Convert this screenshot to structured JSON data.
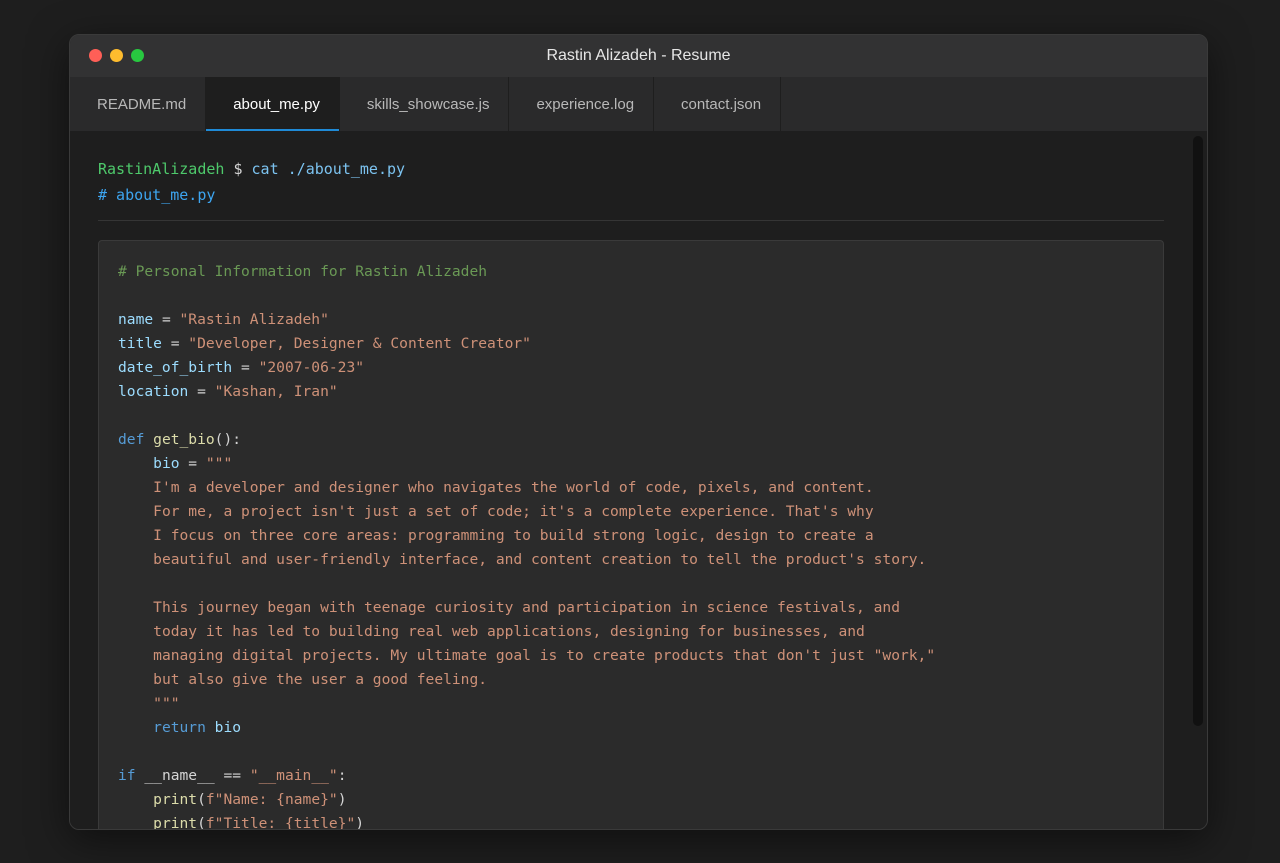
{
  "window": {
    "title": "Rastin Alizadeh - Resume"
  },
  "tabs": [
    {
      "label": "README.md",
      "active": false
    },
    {
      "label": "about_me.py",
      "active": true
    },
    {
      "label": "skills_showcase.js",
      "active": false
    },
    {
      "label": "experience.log",
      "active": false
    },
    {
      "label": "contact.json",
      "active": false
    }
  ],
  "terminal": {
    "prompt_user": "RastinAlizadeh",
    "prompt_symbol": " $ ",
    "command": "cat ./about_me.py",
    "file_comment": "# about_me.py"
  },
  "code": {
    "header_comment": "# Personal Information for Rastin Alizadeh",
    "vars": [
      {
        "name": "name",
        "value": "\"Rastin Alizadeh\""
      },
      {
        "name": "title",
        "value": "\"Developer, Designer & Content Creator\""
      },
      {
        "name": "date_of_birth",
        "value": "\"2007-06-23\""
      },
      {
        "name": "location",
        "value": "\"Kashan, Iran\""
      }
    ],
    "def_kw": "def",
    "fn_name": "get_bio",
    "fn_sig": "():",
    "bio_var": "bio",
    "bio_open": "\"\"\"",
    "bio_lines": [
      "I'm a developer and designer who navigates the world of code, pixels, and content.",
      "For me, a project isn't just a set of code; it's a complete experience. That's why",
      "I focus on three core areas: programming to build strong logic, design to create a",
      "beautiful and user-friendly interface, and content creation to tell the product's story.",
      "",
      "This journey began with teenage curiosity and participation in science festivals, and",
      "today it has led to building real web applications, designing for businesses, and",
      "managing digital projects. My ultimate goal is to create products that don't just \"work,\"",
      "but also give the user a good feeling."
    ],
    "bio_close": "\"\"\"",
    "return_kw": "return",
    "return_val": "bio",
    "if_kw": "if",
    "main_cond_var": "__name__",
    "main_cond_op": " == ",
    "main_cond_str": "\"__main__\"",
    "main_cond_end": ":",
    "print_fn": "print",
    "print1_str": "f\"Name: {name}\"",
    "print2_str": "f\"Title: {title}\""
  }
}
